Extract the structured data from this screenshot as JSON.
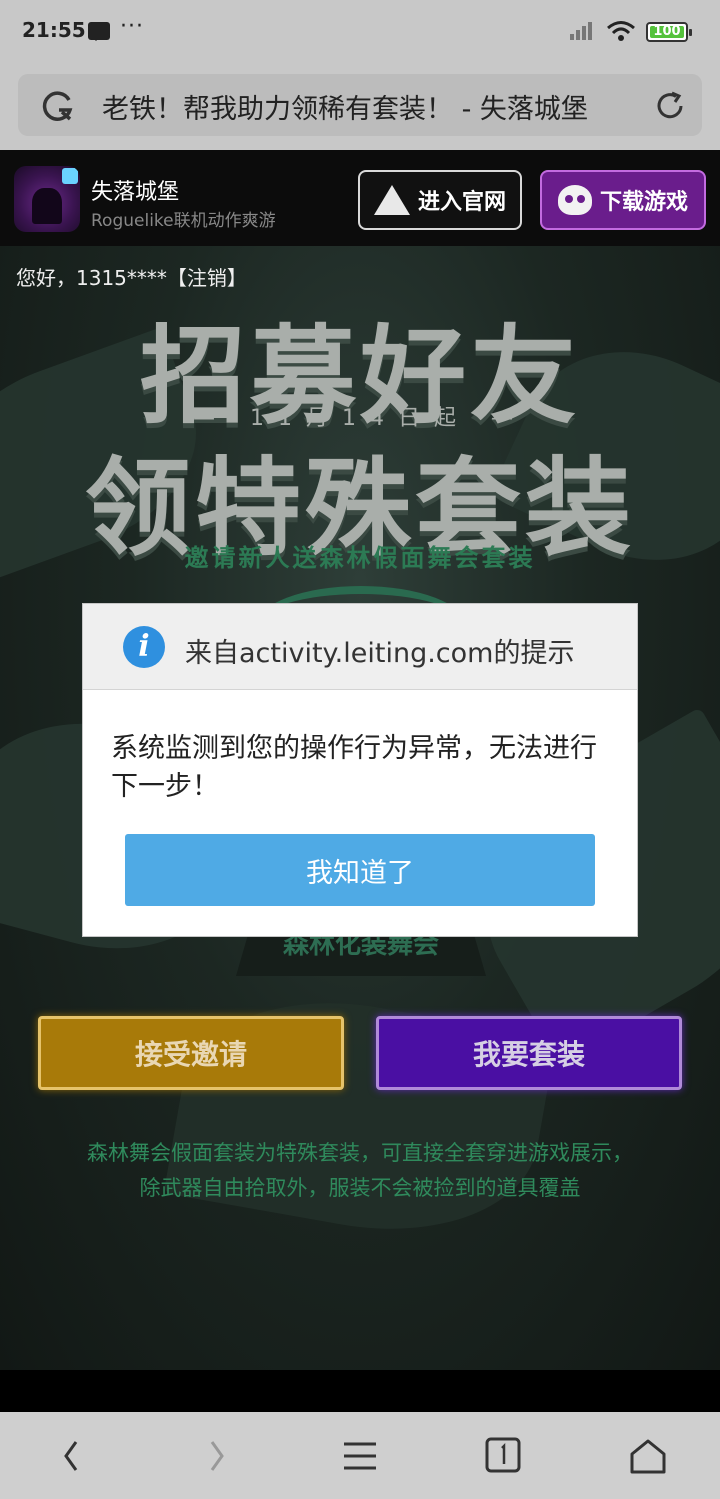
{
  "status_bar": {
    "time": "21:55",
    "more": "···",
    "battery": "100"
  },
  "browser": {
    "title": "老铁！帮我助力领稀有套装！ - 失落城堡"
  },
  "app_header": {
    "name": "失落城堡",
    "tagline": "Roguelike联机动作爽游",
    "official_button": "进入官网",
    "download_button": "下载游戏"
  },
  "page": {
    "greeting": "您好，1315****",
    "logout": "【注销】",
    "title_line1": "招募好友",
    "date_line": "— 11月14日起 —",
    "title_line2": "领特殊套装",
    "subtitle": "邀请新人送森林假面舞会套装",
    "stand_label": "森林化装舞会",
    "accept_button": "接受邀请",
    "suit_button": "我要套装",
    "desc_line1": "森林舞会假面套装为特殊套装，可直接全套穿进游戏展示，",
    "desc_line2": "除武器自由拾取外，服装不会被捡到的道具覆盖"
  },
  "dialog": {
    "title": "来自activity.leiting.com的提示",
    "message": "系统监测到您的操作行为异常，无法进行下一步！",
    "ok_button": "我知道了"
  },
  "colors": {
    "accept_gold": "#a87a09",
    "suit_purple": "#4a0fa3",
    "dialog_button": "#4faae5",
    "download_purple": "#6a1d8c"
  },
  "icons": {
    "browser": [
      "g-icon",
      "refresh-icon"
    ],
    "nav": [
      "back-icon",
      "forward-icon",
      "menu-icon",
      "tabs-icon",
      "home-icon"
    ]
  }
}
